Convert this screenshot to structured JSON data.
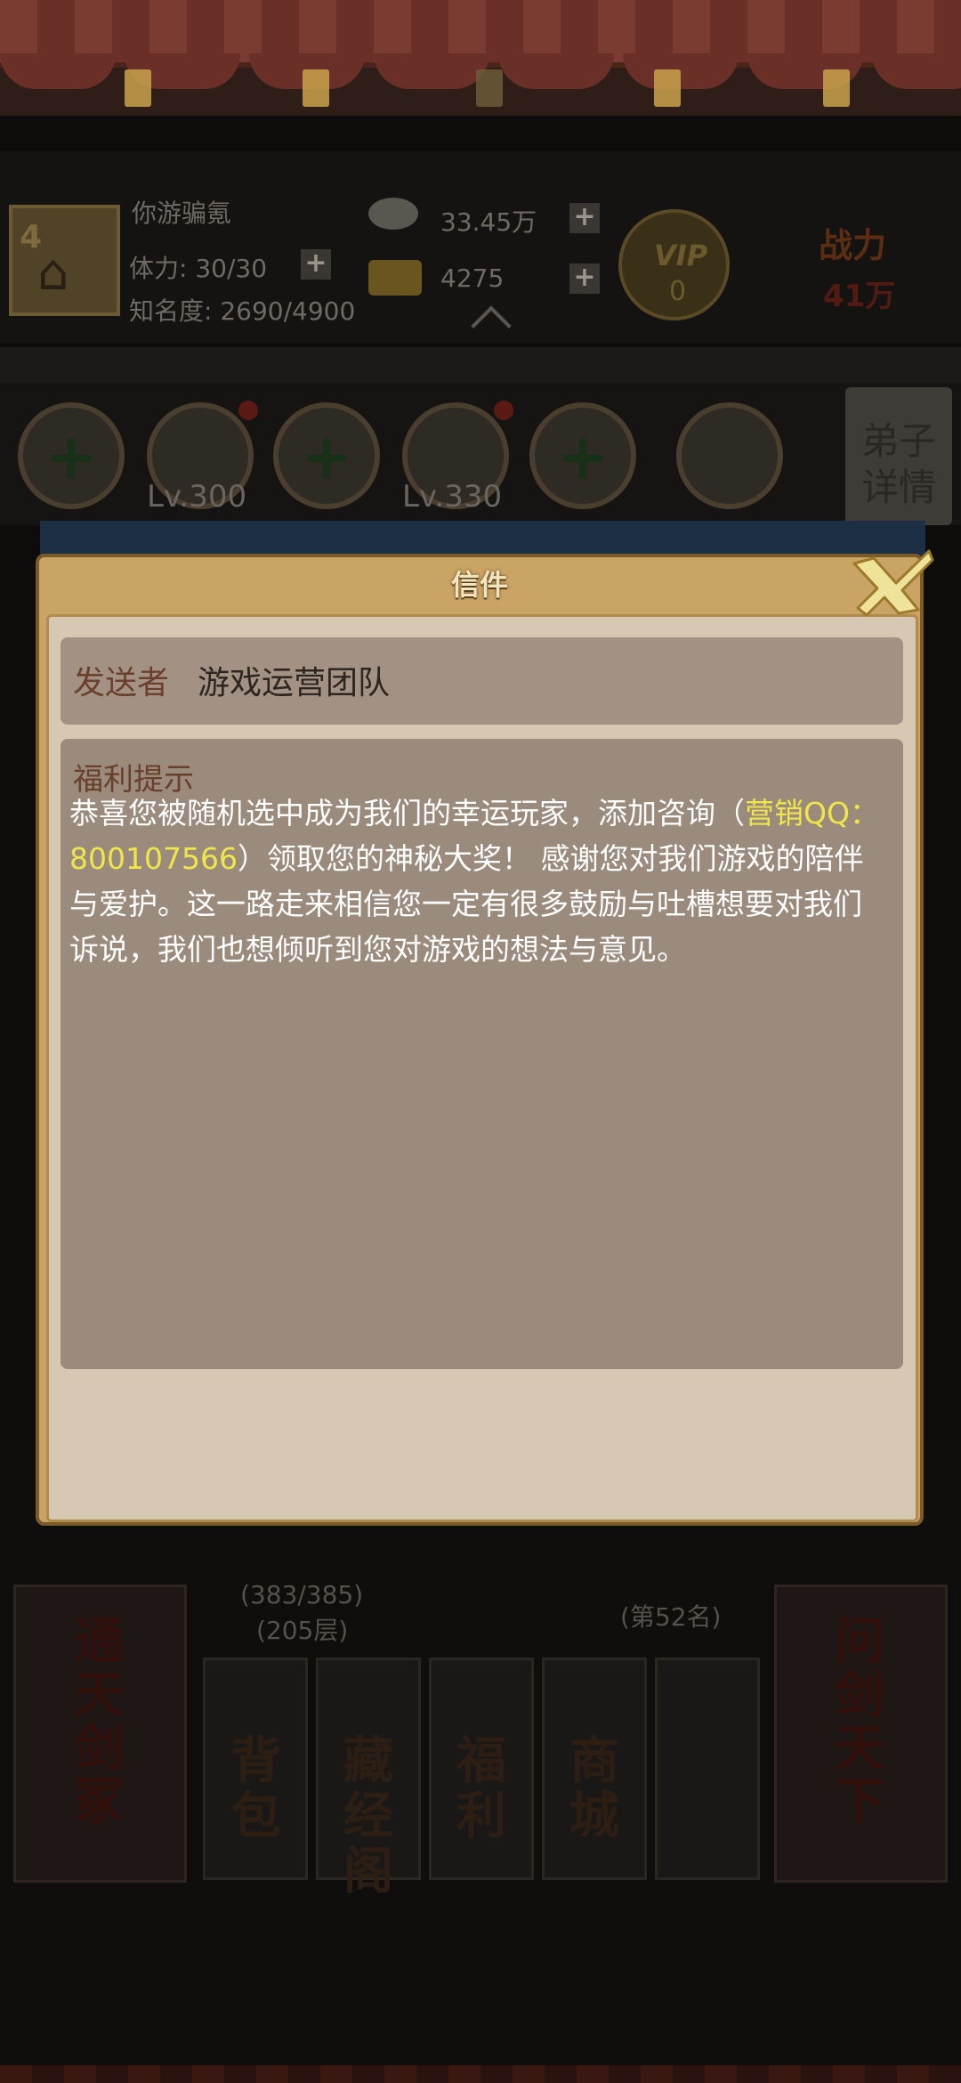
{
  "header": {
    "player_name": "你游骗氪",
    "avatar_level": "4",
    "stamina": "体力: 30/30",
    "fame": "知名度: 2690/4900",
    "silver": "33.45万",
    "gold": "4275",
    "vip_label": "VIP",
    "vip_level": "0",
    "power_label": "战力",
    "power_value": "41万"
  },
  "disciples": {
    "slot_levels": [
      "Lv.300",
      "Lv.330"
    ],
    "detail_button": "弟子详情"
  },
  "bottom": {
    "left_tall": "通天剑冢",
    "right_tall": "问剑天下",
    "stars": "(383/385)",
    "floor": "(205层)",
    "rank": "(第52名)",
    "buttons": [
      "背包",
      "藏经阁",
      "福利",
      "商城"
    ]
  },
  "dialog": {
    "title": "信件",
    "sender_label": "发送者",
    "sender_name": "游戏运营团队",
    "content_title": "福利提示",
    "body_part1": "恭喜您被随机选中成为我们的幸运玩家，添加咨询（",
    "body_highlight": "营销QQ：800107566",
    "body_part2": "）领取您的神秘大奖！ 感谢您对我们游戏的陪伴与爱护。这一路走来相信您一定有很多鼓励与吐槽想要对我们诉说，我们也想倾听到您对游戏的想法与意见。",
    "highlight_color": "#f0e64b"
  }
}
